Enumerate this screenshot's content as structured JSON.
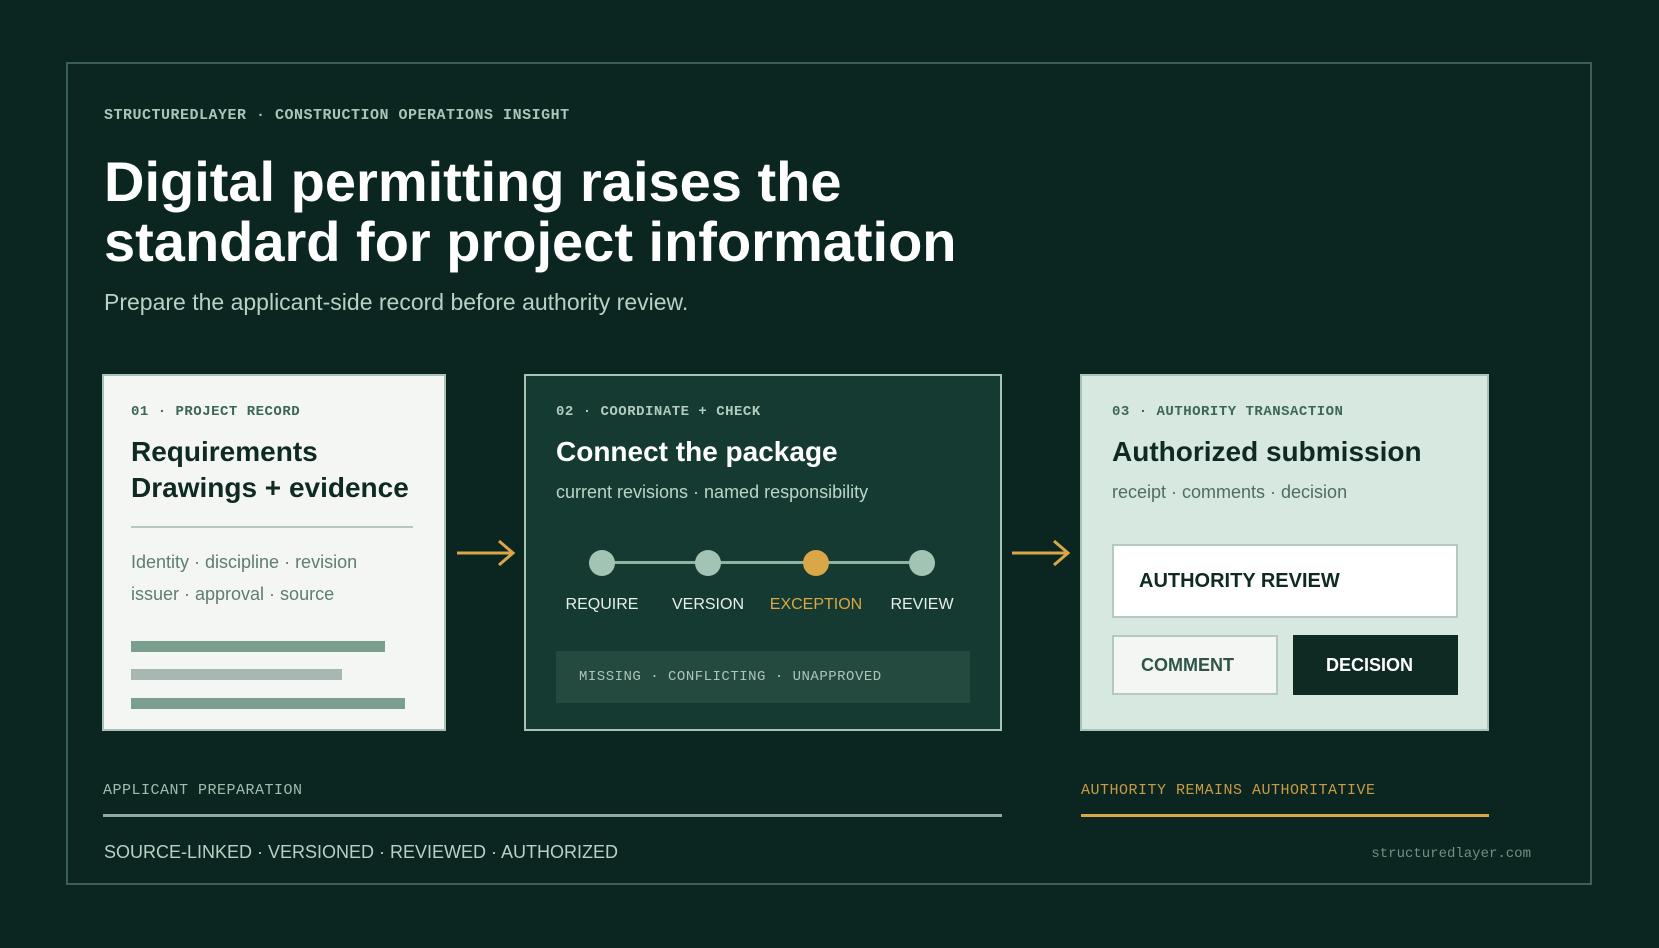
{
  "eyebrow": "STRUCTUREDLAYER · CONSTRUCTION OPERATIONS INSIGHT",
  "title_line1": "Digital permitting raises the",
  "title_line2": "standard for project information",
  "subtitle": "Prepare the applicant-side record before authority review.",
  "card1": {
    "label": "01 · PROJECT RECORD",
    "title_line1": "Requirements",
    "title_line2": "Drawings + evidence",
    "meta_line1": "Identity · discipline · revision",
    "meta_line2": "issuer · approval · source"
  },
  "card2": {
    "label": "02 · COORDINATE + CHECK",
    "title": "Connect the package",
    "subtitle": "current revisions · named responsibility",
    "steps": [
      "REQUIRE",
      "VERSION",
      "EXCEPTION",
      "REVIEW"
    ],
    "highlighted_step": "EXCEPTION",
    "status": "MISSING · CONFLICTING · UNAPPROVED"
  },
  "card3": {
    "label": "03 · AUTHORITY TRANSACTION",
    "title": "Authorized submission",
    "subtitle": "receipt · comments · decision",
    "review": "AUTHORITY REVIEW",
    "comment_button": "COMMENT",
    "decision_button": "DECISION"
  },
  "footer": {
    "applicant": "APPLICANT PREPARATION",
    "authority": "AUTHORITY REMAINS AUTHORITATIVE",
    "tags": "SOURCE-LINKED · VERSIONED · REVIEWED · AUTHORIZED",
    "url": "structuredlayer.com"
  },
  "colors": {
    "background": "#0b2620",
    "accent": "#d9a648",
    "muted_green": "#8fb3a3"
  },
  "icons": [
    "arrow-right-icon",
    "arrow-right-icon"
  ]
}
